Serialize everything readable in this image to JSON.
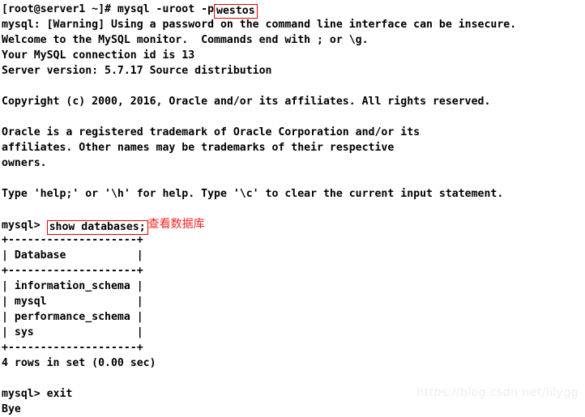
{
  "terminal": {
    "background_color": "#ffffff",
    "text_color": "#000000",
    "highlight_color": "#ee0000",
    "annotation_color": "#ff2222",
    "watermark_color": "#eeeeee",
    "watermark": "https://blog.csdn.net/lilygg"
  },
  "lines": {
    "l1_prompt": "[root@server1 ~]# mysql -uroot -p",
    "l1_password_boxed": "westos",
    "l2": "mysql: [Warning] Using a password on the command line interface can be insecure.",
    "l3": "Welcome to the MySQL monitor.  Commands end with ; or \\g.",
    "l4": "Your MySQL connection id is 13",
    "l5": "Server version: 5.7.17 Source distribution",
    "l6": "",
    "l7": "Copyright (c) 2000, 2016, Oracle and/or its affiliates. All rights reserved.",
    "l8": "",
    "l9": "Oracle is a registered trademark of Oracle Corporation and/or its",
    "l10": "affiliates. Other names may be trademarks of their respective",
    "l11": "owners.",
    "l12": "",
    "l13": "Type 'help;' or '\\h' for help. Type '\\c' to clear the current input statement.",
    "l14": "",
    "l15_prompt": "mysql> ",
    "l15_command_boxed": "show databases;",
    "l15_annotation": "查看数据库",
    "t_top": "+--------------------+",
    "t_header": "| Database           |",
    "t_sep": "+--------------------+",
    "t_row1": "| information_schema |",
    "t_row2": "| mysql              |",
    "t_row3": "| performance_schema |",
    "t_row4": "| sys                |",
    "t_bottom": "+--------------------+",
    "t_footer": "4 rows in set (0.00 sec)",
    "l25": "",
    "l26_prompt": "mysql> ",
    "l26_command": "exit",
    "l27": "Bye"
  }
}
